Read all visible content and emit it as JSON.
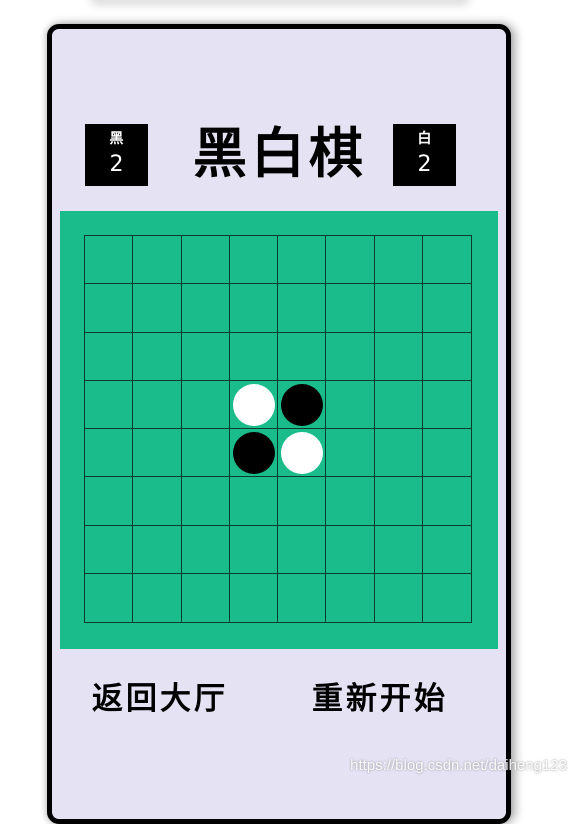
{
  "title": "黑白棋",
  "score": {
    "black": {
      "label": "黑",
      "value": "2"
    },
    "white": {
      "label": "白",
      "value": "2"
    }
  },
  "board": {
    "size": 8,
    "pieces": [
      {
        "row": 3,
        "col": 3,
        "color": "white"
      },
      {
        "row": 3,
        "col": 4,
        "color": "black"
      },
      {
        "row": 4,
        "col": 3,
        "color": "black"
      },
      {
        "row": 4,
        "col": 4,
        "color": "white"
      }
    ]
  },
  "buttons": {
    "back": "返回大厅",
    "restart": "重新开始"
  },
  "watermark": "https://blog.csdn.net/daiheng123",
  "colors": {
    "board": "#1abc8c",
    "background": "#e5e2f3"
  }
}
